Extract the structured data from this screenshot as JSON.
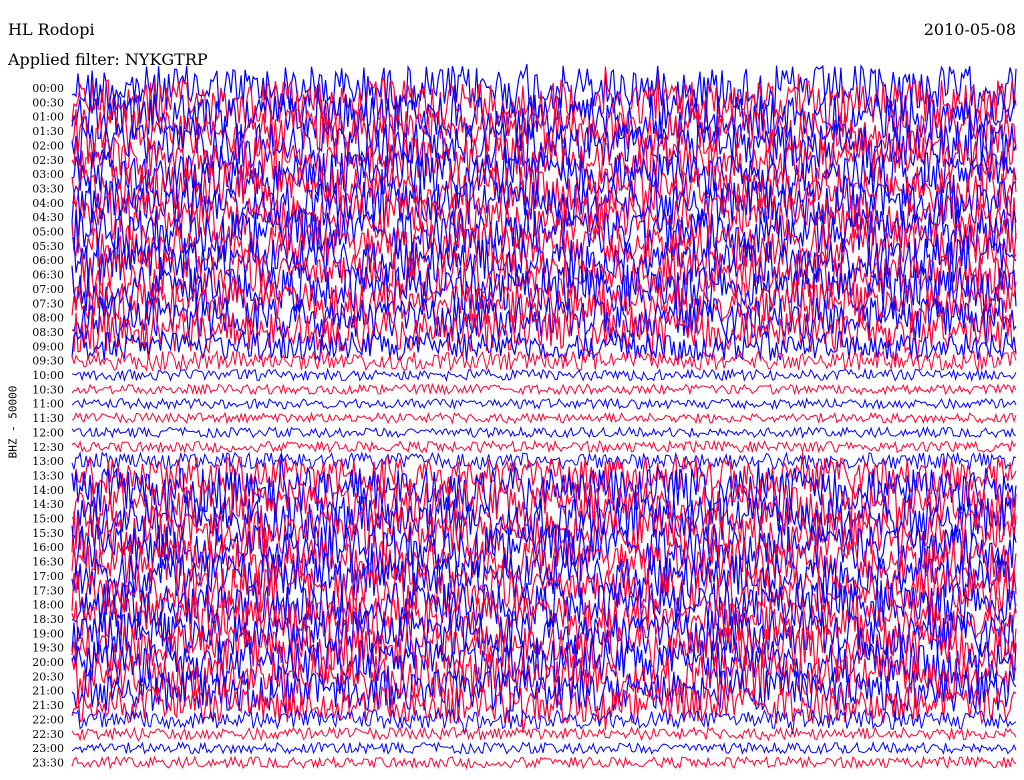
{
  "header": {
    "station": "HL Rodopi",
    "date": "2010-05-08",
    "filter_label": "Applied filter: NYKGTRP"
  },
  "channel_label": "BHZ - 50000",
  "chart_data": {
    "type": "line",
    "title": "HL Rodopi",
    "xlabel": "",
    "ylabel": "BHZ - 50000",
    "categories": [
      "00:00",
      "00:30",
      "01:00",
      "01:30",
      "02:00",
      "02:30",
      "03:00",
      "03:30",
      "04:00",
      "04:30",
      "05:00",
      "05:30",
      "06:00",
      "06:30",
      "07:00",
      "07:30",
      "08:00",
      "08:30",
      "09:00",
      "09:30",
      "10:00",
      "10:30",
      "11:00",
      "11:30",
      "12:00",
      "12:30",
      "13:00",
      "13:30",
      "14:00",
      "14:30",
      "15:00",
      "15:30",
      "16:00",
      "16:30",
      "17:00",
      "17:30",
      "18:00",
      "18:30",
      "19:00",
      "19:30",
      "20:00",
      "20:30",
      "21:00",
      "21:30",
      "22:00",
      "22:30",
      "23:00",
      "23:30"
    ],
    "colors": [
      "#0000ff",
      "#ff0033"
    ],
    "row_noise_level": [
      1.0,
      1.0,
      1.0,
      1.0,
      1.0,
      1.0,
      1.0,
      1.0,
      1.0,
      1.0,
      1.0,
      1.0,
      1.0,
      1.0,
      1.0,
      0.95,
      0.9,
      0.9,
      0.6,
      0.35,
      0.15,
      0.12,
      0.12,
      0.12,
      0.12,
      0.15,
      0.3,
      0.8,
      1.0,
      1.0,
      1.0,
      1.0,
      1.0,
      1.0,
      1.0,
      1.0,
      1.0,
      1.0,
      1.0,
      1.0,
      1.0,
      1.0,
      0.9,
      0.8,
      0.35,
      0.18,
      0.15,
      0.15
    ],
    "grid": false,
    "legend": "none"
  }
}
